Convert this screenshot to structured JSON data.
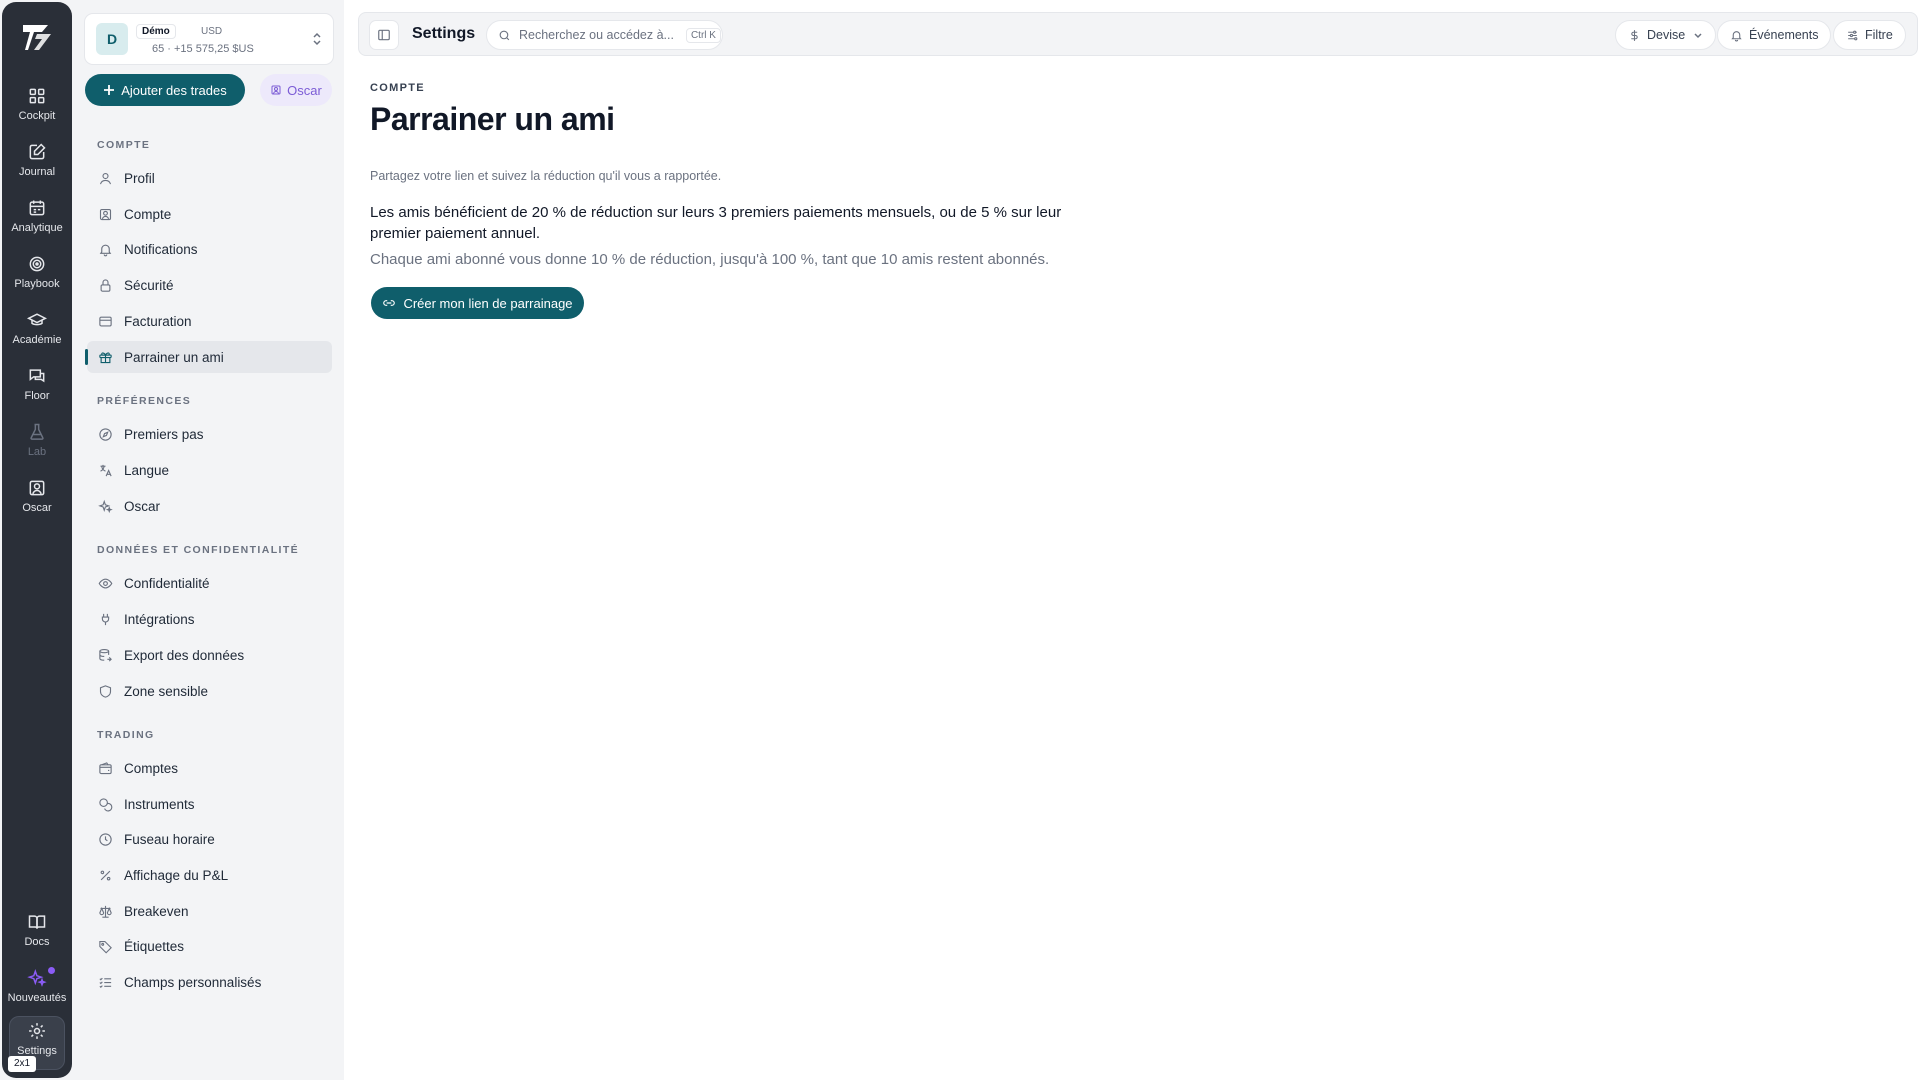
{
  "rail": {
    "items": [
      {
        "label": "Cockpit",
        "icon": "grid-icon"
      },
      {
        "label": "Journal",
        "icon": "edit-icon"
      },
      {
        "label": "Analytique",
        "icon": "calendar-icon"
      },
      {
        "label": "Playbook",
        "icon": "target-icon"
      },
      {
        "label": "Académie",
        "icon": "graduation-cap-icon"
      },
      {
        "label": "Floor",
        "icon": "chat-icon"
      },
      {
        "label": "Lab",
        "icon": "flask-icon"
      },
      {
        "label": "Oscar",
        "icon": "user-square-icon"
      }
    ],
    "bottom": [
      {
        "label": "Docs",
        "icon": "book-icon"
      },
      {
        "label": "Nouveautés",
        "icon": "sparkles-icon"
      },
      {
        "label": "Settings",
        "icon": "gear-icon"
      }
    ],
    "badge": "2x1"
  },
  "account": {
    "avatar": "D",
    "mode": "Démo",
    "currency": "USD",
    "summary": "65 · +15 575,25 $US"
  },
  "actions": {
    "add_trades": "Ajouter des trades",
    "oscar": "Oscar"
  },
  "sections": [
    {
      "title": "Compte",
      "items": [
        "Profil",
        "Compte",
        "Notifications",
        "Sécurité",
        "Facturation",
        "Parrainer un ami"
      ]
    },
    {
      "title": "Préférences",
      "items": [
        "Premiers pas",
        "Langue",
        "Oscar"
      ]
    },
    {
      "title": "Données et confidentialité",
      "items": [
        "Confidentialité",
        "Intégrations",
        "Export des données",
        "Zone sensible"
      ]
    },
    {
      "title": "Trading",
      "items": [
        "Comptes",
        "Instruments",
        "Fuseau horaire",
        "Affichage du P&L",
        "Breakeven",
        "Étiquettes",
        "Champs personnalisés"
      ]
    }
  ],
  "active_item": "Parrainer un ami",
  "topbar": {
    "title": "Settings",
    "search_placeholder": "Recherchez ou accédez à...",
    "search_shortcut": "Ctrl K",
    "currency_label": "Devise",
    "events_label": "Événements",
    "filter_label": "Filtre"
  },
  "page": {
    "breadcrumb": "Compte",
    "title": "Parrainer un ami",
    "lead": "Partagez votre lien et suivez la réduction qu'il vous a rapportée.",
    "body1": "Les amis bénéficient de 20 % de réduction sur leurs 3 premiers paiements mensuels, ou de 5 % sur leur premier paiement annuel.",
    "body2": "Chaque ami abonné vous donne 10 % de réduction, jusqu'à 100 %, tant que 10 amis restent abonnés.",
    "cta": "Créer mon lien de parrainage"
  },
  "colors": {
    "accent": "#0f5e6b",
    "rail_bg": "#2a2f38",
    "oscar_accent": "#7c5cd6"
  }
}
